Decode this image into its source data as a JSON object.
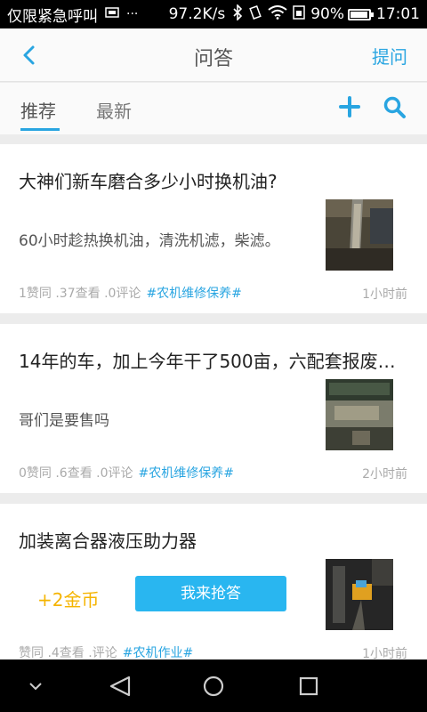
{
  "status_bar": {
    "carrier": "仅限紧急呼叫",
    "dots": "···",
    "speed": "97.2K/s",
    "battery": "90%",
    "battery_level": 0.9,
    "time": "17:01"
  },
  "header": {
    "title": "问答",
    "ask_label": "提问"
  },
  "tabs": [
    {
      "label": "推荐",
      "active": true
    },
    {
      "label": "最新",
      "active": false
    }
  ],
  "questions": [
    {
      "title": "大神们新车磨合多少小时换机油?",
      "answer": "60小时趁热换机油，清洗机滤，柴滤。",
      "meta": "1赞同 .37查看 .0评论",
      "tag": "#农机维修保养#",
      "time": "1小时前"
    },
    {
      "title": "14年的车，加上今年干了500亩，六配套报废…",
      "answer": "哥们是要售吗",
      "meta": "0赞同 .6查看 .0评论",
      "tag": "#农机维修保养#",
      "time": "2小时前"
    },
    {
      "title": "加装离合器液压助力器",
      "coins": "+2金币",
      "answer_button": "我来抢答",
      "meta": "赞同 .4查看 .评论",
      "tag": "#农机作业#",
      "time": "1小时前"
    }
  ],
  "colors": {
    "accent": "#29a5e1",
    "button": "#29b6f0",
    "coins": "#f5b400"
  }
}
